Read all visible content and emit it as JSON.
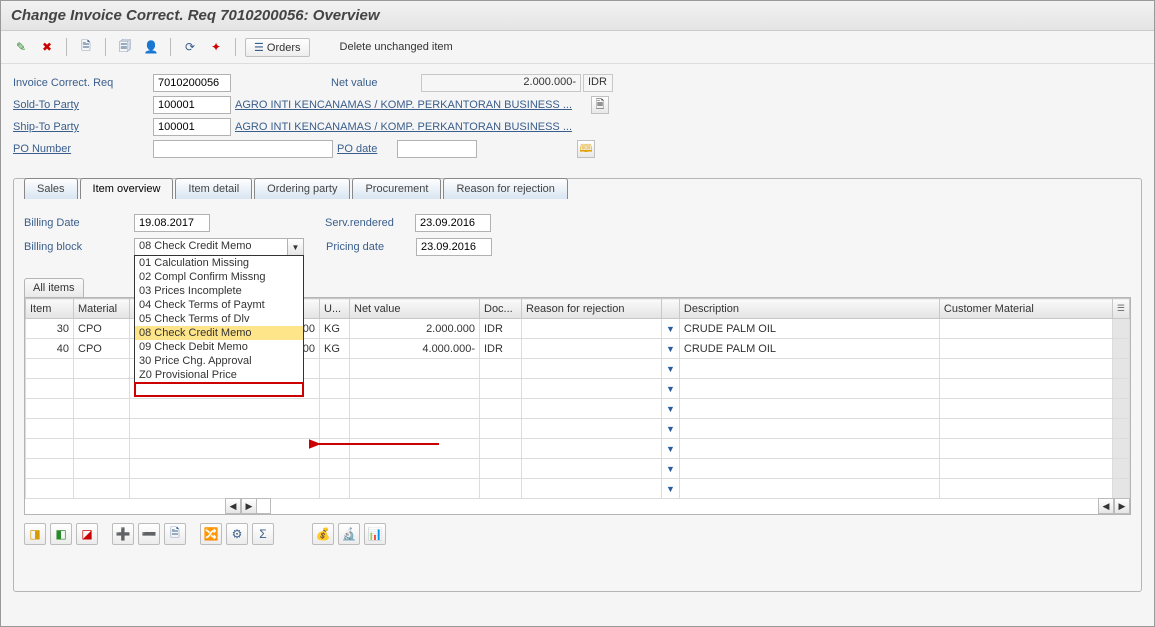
{
  "title": "Change Invoice Correct. Req 7010200056: Overview",
  "toolbar": {
    "orders": "Orders",
    "delete_unchanged": "Delete unchanged item"
  },
  "header": {
    "invoice_correct_req_label": "Invoice Correct. Req",
    "invoice_correct_req": "7010200056",
    "net_value_label": "Net value",
    "net_value": "2.000.000-",
    "currency": "IDR",
    "sold_to_label": "Sold-To Party",
    "sold_to": "100001",
    "sold_to_name": "AGRO INTI KENCANAMAS / KOMP. PERKANTORAN BUSINESS ...",
    "ship_to_label": "Ship-To Party",
    "ship_to": "100001",
    "ship_to_name": "AGRO INTI KENCANAMAS / KOMP. PERKANTORAN BUSINESS ...",
    "po_number_label": "PO Number",
    "po_number": "",
    "po_date_label": "PO date",
    "po_date": ""
  },
  "tabs": {
    "sales": "Sales",
    "item_overview": "Item overview",
    "item_detail": "Item detail",
    "ordering_party": "Ordering party",
    "procurement": "Procurement",
    "reason_for_rejection": "Reason for rejection"
  },
  "overview": {
    "billing_date_label": "Billing Date",
    "billing_date": "19.08.2017",
    "serv_rendered_label": "Serv.rendered",
    "serv_rendered": "23.09.2016",
    "billing_block_label": "Billing block",
    "billing_block_value": "08 Check Credit Memo",
    "pricing_date_label": "Pricing date",
    "pricing_date": "23.09.2016",
    "billing_block_options": [
      "01 Calculation Missing",
      "02 Compl Confirm Missng",
      "03 Prices Incomplete",
      "04 Check Terms of Paymt",
      "05 Check Terms of Dlv",
      "08 Check Credit Memo",
      "09 Check Debit Memo",
      "30 Price Chg. Approval",
      "Z0 Provisional Price"
    ],
    "all_items_label": "All items"
  },
  "columns": {
    "item": "Item",
    "material": "Material",
    "order_qty": "",
    "uom": "U...",
    "net_value": "Net value",
    "doc": "Doc...",
    "reason": "Reason for rejection",
    "description": "Description",
    "cust_mat": "Customer Material"
  },
  "rows": [
    {
      "item": "30",
      "material": "CPO",
      "qty": "200",
      "uom": "KG",
      "net_value": "2.000.000",
      "doc": "IDR",
      "desc": "CRUDE PALM OIL"
    },
    {
      "item": "40",
      "material": "CPO",
      "qty": "200",
      "uom": "KG",
      "net_value": "4.000.000-",
      "doc": "IDR",
      "desc": "CRUDE PALM OIL"
    }
  ]
}
